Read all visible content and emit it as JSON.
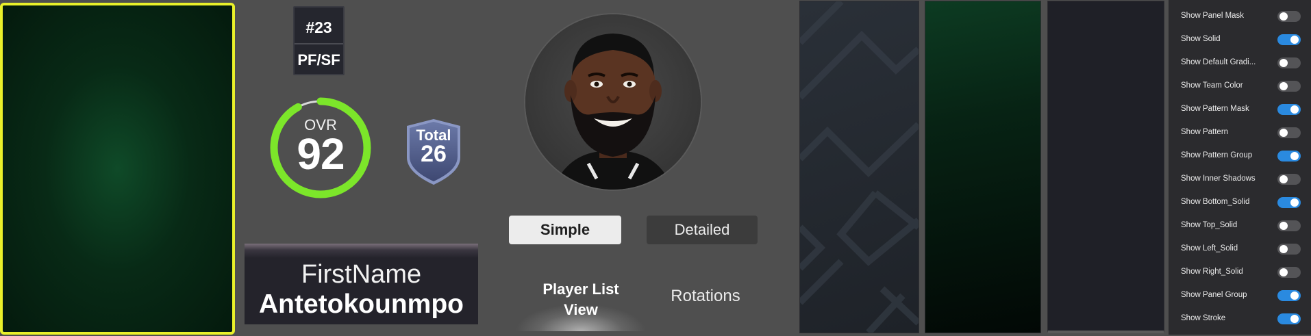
{
  "player": {
    "number": "#23",
    "position": "PF/SF",
    "ovr_label": "OVR",
    "ovr_value": "92",
    "total_label": "Total",
    "total_value": "26",
    "first_name": "FirstName",
    "last_name": "Antetokounmpo"
  },
  "colors": {
    "card_border": "#e9f02a",
    "ovr_ring": "#7ce62a",
    "toggle_on": "#2a8ae0",
    "toggle_off": "#545457"
  },
  "tabs": {
    "simple": "Simple",
    "detailed": "Detailed",
    "active": "Simple"
  },
  "views": {
    "player_list": "Player List View",
    "player_list_line1": "Player List",
    "player_list_line2": "View",
    "rotations": "Rotations",
    "active": "Player List View"
  },
  "toggles": [
    {
      "label": "Show Panel Mask",
      "on": false
    },
    {
      "label": "Show Solid",
      "on": true
    },
    {
      "label": "Show Default Gradi...",
      "on": false
    },
    {
      "label": "Show Team Color",
      "on": false
    },
    {
      "label": "Show Pattern Mask",
      "on": true
    },
    {
      "label": "Show Pattern",
      "on": false
    },
    {
      "label": "Show Pattern Group",
      "on": true
    },
    {
      "label": "Show Inner Shadows",
      "on": false
    },
    {
      "label": "Show Bottom_Solid",
      "on": true
    },
    {
      "label": "Show Top_Solid",
      "on": false
    },
    {
      "label": "Show Left_Solid",
      "on": false
    },
    {
      "label": "Show Right_Solid",
      "on": false
    },
    {
      "label": "Show Panel Group",
      "on": true
    },
    {
      "label": "Show Stroke",
      "on": true
    }
  ]
}
